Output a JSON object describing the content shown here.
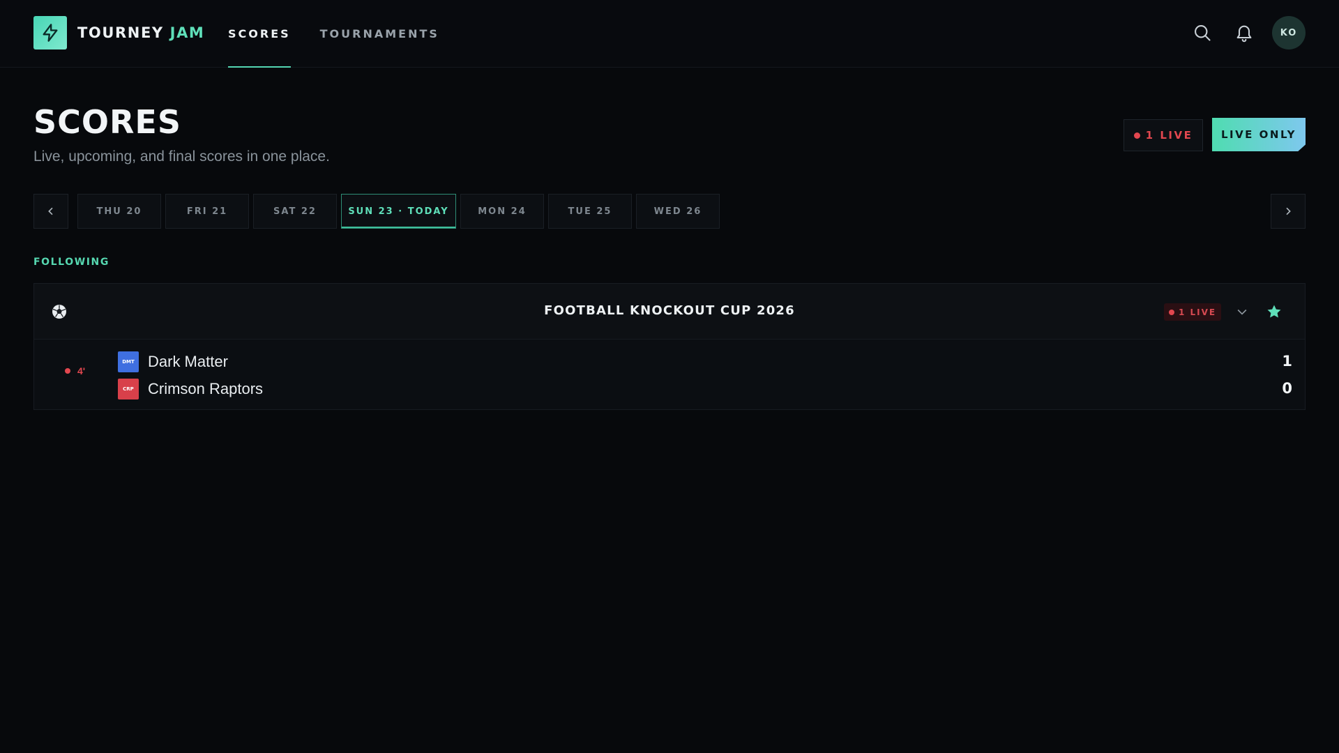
{
  "brand": {
    "name_part1": "TOURNEY",
    "name_part2": "JAM",
    "logo_icon": "lightning-bolt-icon"
  },
  "nav": {
    "items": [
      {
        "label": "SCORES",
        "active": true
      },
      {
        "label": "TOURNAMENTS",
        "active": false
      }
    ]
  },
  "header_icons": {
    "search_icon": "search-icon",
    "bell_icon": "bell-icon",
    "avatar_initials": "KO"
  },
  "page": {
    "title": "SCORES",
    "subtitle": "Live, upcoming, and final scores in one place.",
    "live_count_label": "1 LIVE",
    "live_only_label": "LIVE ONLY"
  },
  "dates": {
    "items": [
      {
        "label": "THU 20",
        "active": false
      },
      {
        "label": "FRI 21",
        "active": false
      },
      {
        "label": "SAT 22",
        "active": false
      },
      {
        "label": "SUN 23 · TODAY",
        "active": true
      },
      {
        "label": "MON 24",
        "active": false
      },
      {
        "label": "TUE 25",
        "active": false
      },
      {
        "label": "WED 26",
        "active": false
      }
    ]
  },
  "following": {
    "label": "FOLLOWING",
    "tournament": {
      "name": "FOOTBALL KNOCKOUT CUP 2026",
      "sport_icon": "soccer-ball-icon",
      "live_label": "1 LIVE",
      "favorited": true,
      "match": {
        "minute": "4'",
        "teams": [
          {
            "abbr": "DMT",
            "name": "Dark Matter",
            "score": "1",
            "color": "#3f6fe0"
          },
          {
            "abbr": "CRP",
            "name": "Crimson Raptors",
            "score": "0",
            "color": "#d8404a"
          }
        ]
      }
    }
  },
  "colors": {
    "accent": "#54d6b2",
    "live": "#e2474f",
    "background": "#07090c"
  }
}
